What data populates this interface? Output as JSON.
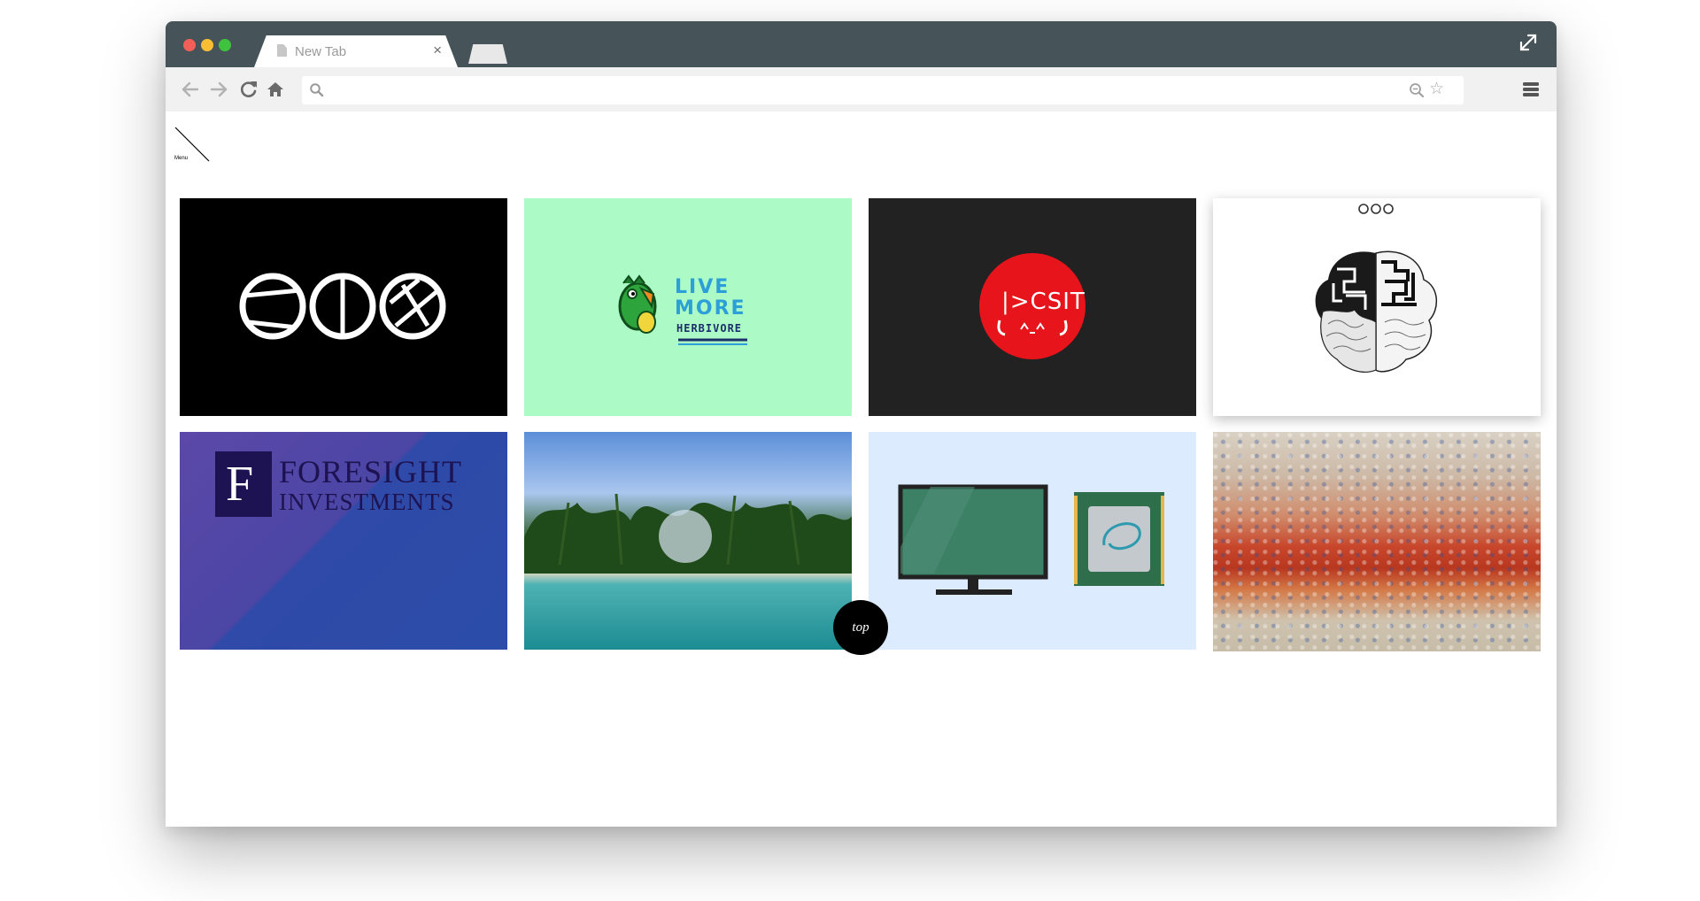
{
  "browser": {
    "tab_title": "New Tab",
    "tab_close": "×",
    "address_placeholder": "",
    "icons": [
      "back-arrow-icon",
      "forward-arrow-icon",
      "reload-icon",
      "home-icon",
      "search-icon",
      "zoom-icon",
      "star-icon",
      "hamburger-menu-icon",
      "fullscreen-icon"
    ]
  },
  "page": {
    "menu_label": "Menu",
    "tiles": [
      {
        "name": "three-circle-logo",
        "bg": "#000000"
      },
      {
        "name": "live-more-herbivore",
        "line1": "LIVE",
        "line2": "MORE",
        "line3": "HERBIVORE",
        "bg": "#acfbc6"
      },
      {
        "name": "csit-logo",
        "text": "|>CSIT",
        "bg": "#222222",
        "accent": "#e8141b"
      },
      {
        "name": "brain-illustration",
        "bg": "#ffffff"
      },
      {
        "name": "foresight-investments",
        "letter": "F",
        "line1": "FORESIGHT",
        "line2": "INVESTMENTS",
        "brand": "#1d1352"
      },
      {
        "name": "tropical-island-photo"
      },
      {
        "name": "monitor-and-cpu-illustration",
        "bg": "#dcebfd"
      },
      {
        "name": "abstract-painting"
      }
    ],
    "top_button": "top"
  }
}
